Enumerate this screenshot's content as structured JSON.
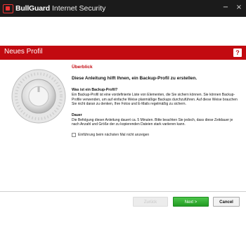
{
  "titlebar": {
    "brand_name": "BullGuard",
    "brand_suffix": "Internet Security",
    "minimize_glyph": "−",
    "close_glyph": "×"
  },
  "header": {
    "title": "Neues Profil",
    "help_label": "?"
  },
  "content": {
    "section_title": "Überblick",
    "lead": "Diese Anleitung hilft Ihnen, ein Backup-Profil zu erstellen.",
    "what_title": "Was ist ein Backup-Profil?",
    "what_text": "Ein Backup-Profil ist eine vordefinierte Liste von Elementen, die Sie sichern können. Sie können Backup-Profile verwenden, um auf einfache Weise planmäßige Backups durchzuführen. Auf diese Weise brauchen Sie nicht daran zu denken, Ihre Fotos und E-Mails regelmäßig zu sichern.",
    "duration_title": "Dauer",
    "duration_text": "Die Befolgung dieser Anleitung dauert ca. 5 Minuten. Bitte beachten Sie jedoch, dass diese Zeitdauer je nach Anzahl und Größe der zu kopierenden Dateien stark variieren kann.",
    "skip_intro_label": "Einführung beim nächsten Mal nicht anzeigen",
    "skip_intro_checked": false
  },
  "footer": {
    "back_label": "Zurück",
    "next_label": "Next >",
    "cancel_label": "Cancel"
  },
  "colors": {
    "accent": "#c20a10",
    "titlebar": "#1b1b1b",
    "next_button": "#2fa82f"
  }
}
